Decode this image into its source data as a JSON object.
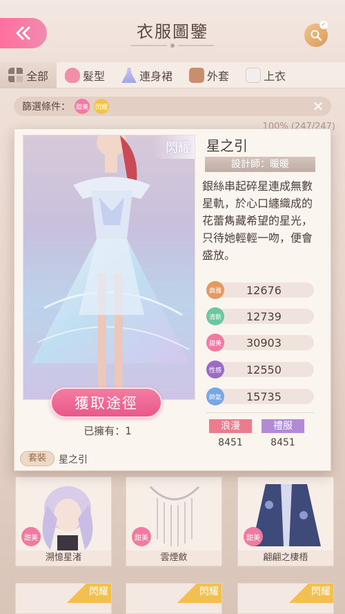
{
  "header": {
    "title": "衣服圖鑒"
  },
  "tabs": [
    {
      "label": "全部",
      "active": true
    },
    {
      "label": "髮型"
    },
    {
      "label": "連身裙"
    },
    {
      "label": "外套"
    },
    {
      "label": "上衣"
    }
  ],
  "filter": {
    "label": "篩選條件：",
    "chips": [
      "甜美",
      "閃耀"
    ],
    "progress": "100% (247/247)"
  },
  "item": {
    "name": "星之引",
    "designer": "設計師：暖暖",
    "description": "銀絲串起碎星連成無數星軌，於心口纏織成的花蕾雋藏希望的星光，只待她輕輕一吻，便會盛放。",
    "shine_tag": "閃耀",
    "acquire_label": "獲取途徑",
    "owned": "已擁有：1",
    "stats": [
      {
        "attr": "典雅",
        "value": "12676",
        "color": "#e39a62"
      },
      {
        "attr": "清新",
        "value": "12739",
        "color": "#6cc79e"
      },
      {
        "attr": "甜美",
        "value": "30903",
        "color": "#f27aa2"
      },
      {
        "attr": "性感",
        "value": "12550",
        "color": "#9a6bc6"
      },
      {
        "attr": "帥氣",
        "value": "15735",
        "color": "#79a7e6"
      }
    ],
    "themes": [
      {
        "label": "浪漫",
        "value": "8451",
        "color": "#ec7b8e"
      },
      {
        "label": "禮服",
        "value": "8451",
        "color": "#b38ad6"
      }
    ],
    "set_label": "套裝",
    "set_name": "星之引"
  },
  "grid": [
    {
      "name": "溯憶星渚",
      "badge": "甜美"
    },
    {
      "name": "雲煙斂",
      "badge": "甜美"
    },
    {
      "name": "翩翩之棲梧",
      "badge": "甜美"
    }
  ],
  "bottom_ribbon": "閃耀"
}
